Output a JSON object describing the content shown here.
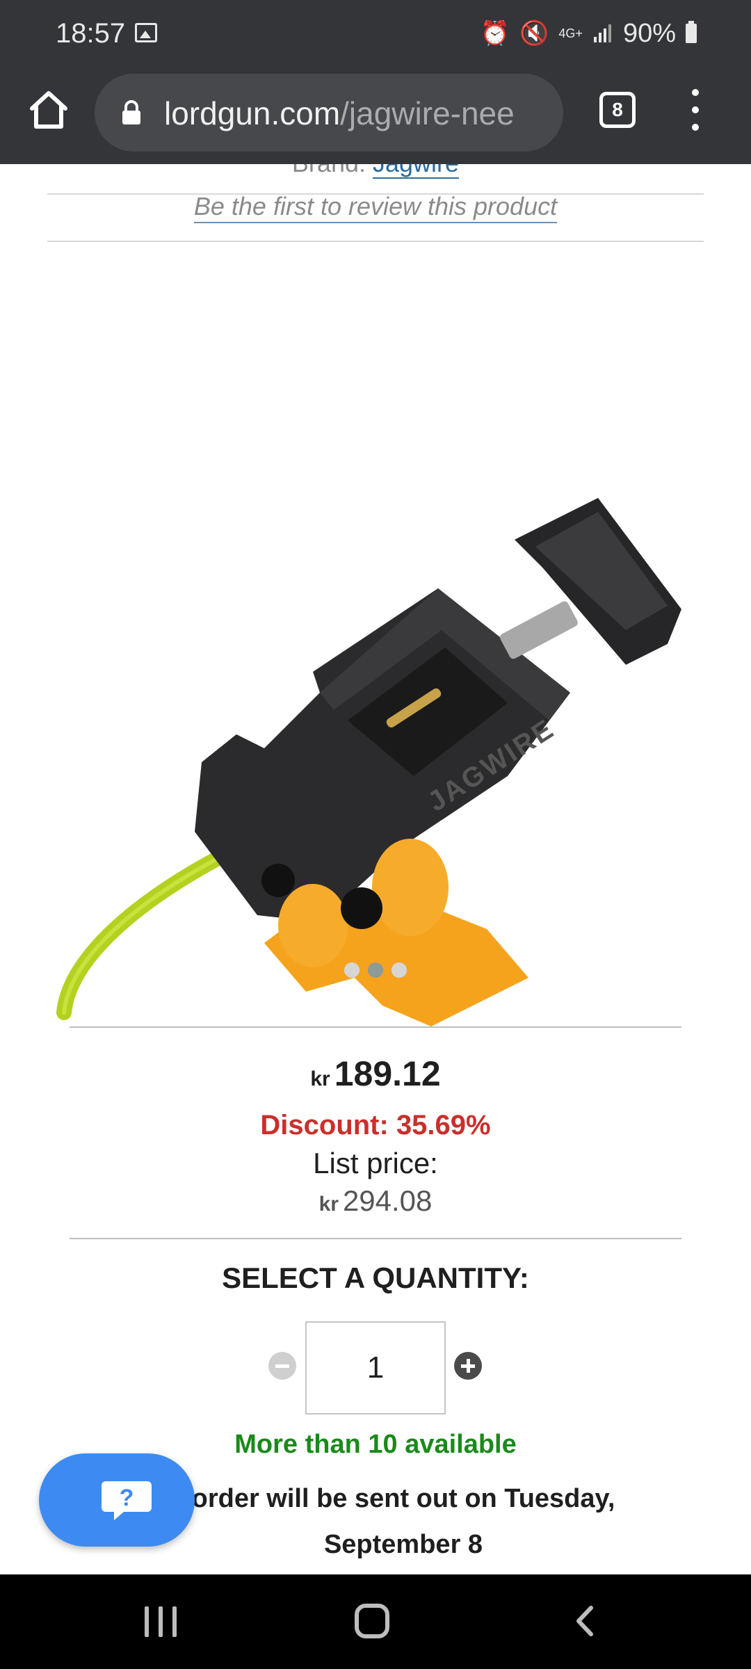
{
  "status_bar": {
    "time": "18:57",
    "icons": [
      "gallery-icon",
      "alarm-icon",
      "mute-icon",
      "4g-icon",
      "signal-icon",
      "battery-icon"
    ],
    "network": "4G+",
    "battery": "90%"
  },
  "browser": {
    "url_host": "lordgun.com",
    "url_path": "/jagwire-nee",
    "tab_count": "8"
  },
  "product": {
    "brand_prefix": "Brand: ",
    "brand": "Jagwire",
    "review_link": "Be the first to review this product",
    "image_count": 3,
    "active_image": 2,
    "currency": "kr",
    "price": "189.12",
    "discount": "Discount: 35.69%",
    "list_price_label": "List price:",
    "list_price": "294.08"
  },
  "quantity": {
    "title": "SELECT A QUANTITY:",
    "value": "1",
    "availability": "More than 10 available",
    "shipping": "order will be sent out on Tuesday, September 8"
  },
  "colors": {
    "status_bar_bg": "#333538",
    "price_discount": "#c9302c",
    "availability": "#1a8a1a",
    "chat_button": "#3d8bf2"
  }
}
